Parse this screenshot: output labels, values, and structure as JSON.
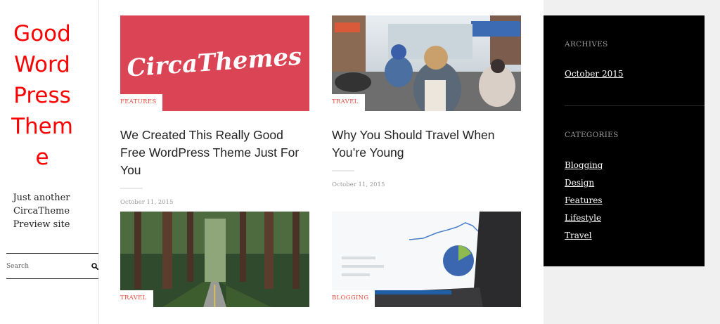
{
  "site": {
    "title": "Good Word Press Theme",
    "tagline": "Just another CircaTheme Preview site"
  },
  "search": {
    "placeholder": "Search",
    "icon": "search-icon"
  },
  "posts": [
    {
      "category": "FEATURES",
      "title": "We Created This Really Good Free WordPress Theme Just For You",
      "date": "October 11, 2015",
      "image_text": "CircaThemes"
    },
    {
      "category": "TRAVEL",
      "title": "Why You Should Travel When You’re Young",
      "date": "October 11, 2015"
    },
    {
      "category": "TRAVEL"
    },
    {
      "category": "BLOGGING"
    }
  ],
  "widgets": {
    "archives": {
      "title": "ARCHIVES",
      "items": [
        "October 2015"
      ]
    },
    "categories": {
      "title": "CATEGORIES",
      "items": [
        "Blogging",
        "Design",
        "Features",
        "Lifestyle",
        "Travel"
      ]
    }
  },
  "colors": {
    "site_title": "#ff0000",
    "accent": "#e74c3c",
    "feature_bg": "#db4455",
    "widget_bg": "#000000"
  }
}
